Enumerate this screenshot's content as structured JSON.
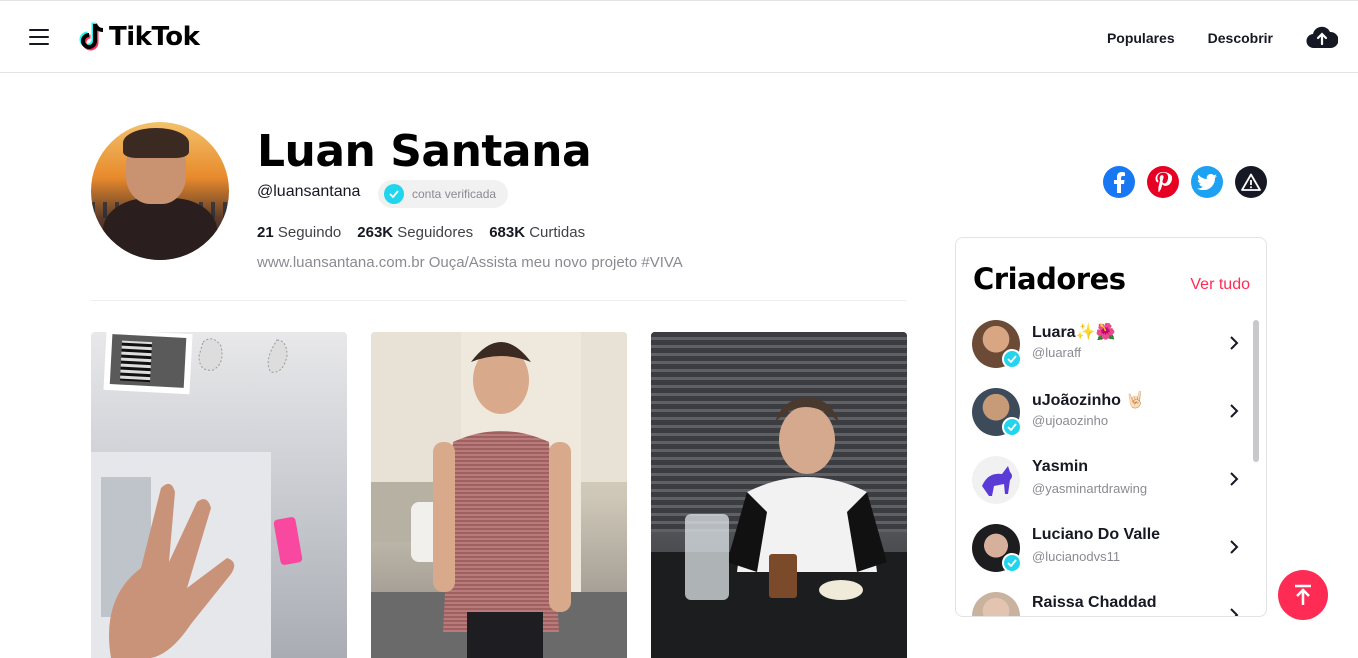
{
  "header": {
    "logo_text": "TikTok",
    "nav": {
      "popular": "Populares",
      "discover": "Descobrir"
    },
    "icons": [
      "menu-icon",
      "upload-cloud-icon"
    ]
  },
  "profile": {
    "name": "Luan Santana",
    "handle": "@luansantana",
    "verified_label": "conta verificada",
    "stats": {
      "following_count": "21",
      "following_label": "Seguindo",
      "followers_count": "263K",
      "followers_label": "Seguidores",
      "likes_count": "683K",
      "likes_label": "Curtidas"
    },
    "bio": "www.luansantana.com.br Ouça/Assista meu novo projeto #VIVA"
  },
  "share_icons": [
    "facebook-icon",
    "pinterest-icon",
    "twitter-icon",
    "report-icon"
  ],
  "creators": {
    "title": "Criadores",
    "see_all": "Ver tudo",
    "items": [
      {
        "name": "Luara✨🌺",
        "handle": "@luaraff",
        "verified": true
      },
      {
        "name": "uJoãozinho 🤘🏻",
        "handle": "@ujoaozinho",
        "verified": true
      },
      {
        "name": "Yasmin",
        "handle": "@yasminartdrawing",
        "verified": false
      },
      {
        "name": "Luciano Do Valle",
        "handle": "@lucianodvs11",
        "verified": true
      },
      {
        "name": "Raissa Chaddad",
        "handle": "",
        "verified": false
      }
    ]
  },
  "colors": {
    "accent": "#fe2c55",
    "verified": "#20d5ec",
    "text": "#161823",
    "muted": "#8a8b91"
  }
}
